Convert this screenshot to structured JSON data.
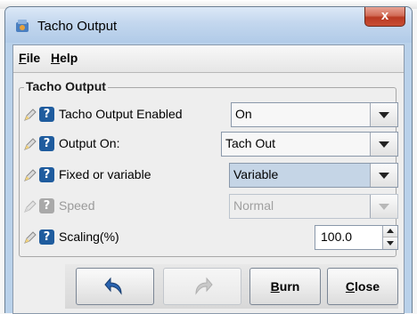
{
  "window": {
    "title": "Tacho Output",
    "close_glyph": "x"
  },
  "menu": {
    "items": [
      {
        "mnemonic": "F",
        "rest": "ile"
      },
      {
        "mnemonic": "H",
        "rest": "elp"
      }
    ]
  },
  "group": {
    "title": "Tacho Output"
  },
  "rows": [
    {
      "label": "Tacho Output Enabled",
      "value": "On",
      "enabled": true
    },
    {
      "label": "Output On:",
      "value": "Tach Out",
      "enabled": true
    },
    {
      "label": "Fixed or variable",
      "value": "Variable",
      "enabled": true
    },
    {
      "label": "Speed",
      "value": "Normal",
      "enabled": false
    },
    {
      "label": "Scaling(%)",
      "value": "100.0",
      "enabled": true
    }
  ],
  "help_glyph": "?",
  "buttons": {
    "undo_icon": "undo-arrow-icon",
    "redo_icon": "redo-arrow-icon",
    "burn": {
      "mnemonic": "B",
      "rest": "urn"
    },
    "close": {
      "mnemonic": "C",
      "rest": "lose"
    }
  },
  "colors": {
    "titlebar": "#c3d7ee",
    "close_button": "#c84e34",
    "help_icon": "#1f5c9e",
    "selected_combo": "#c5d5e6"
  }
}
